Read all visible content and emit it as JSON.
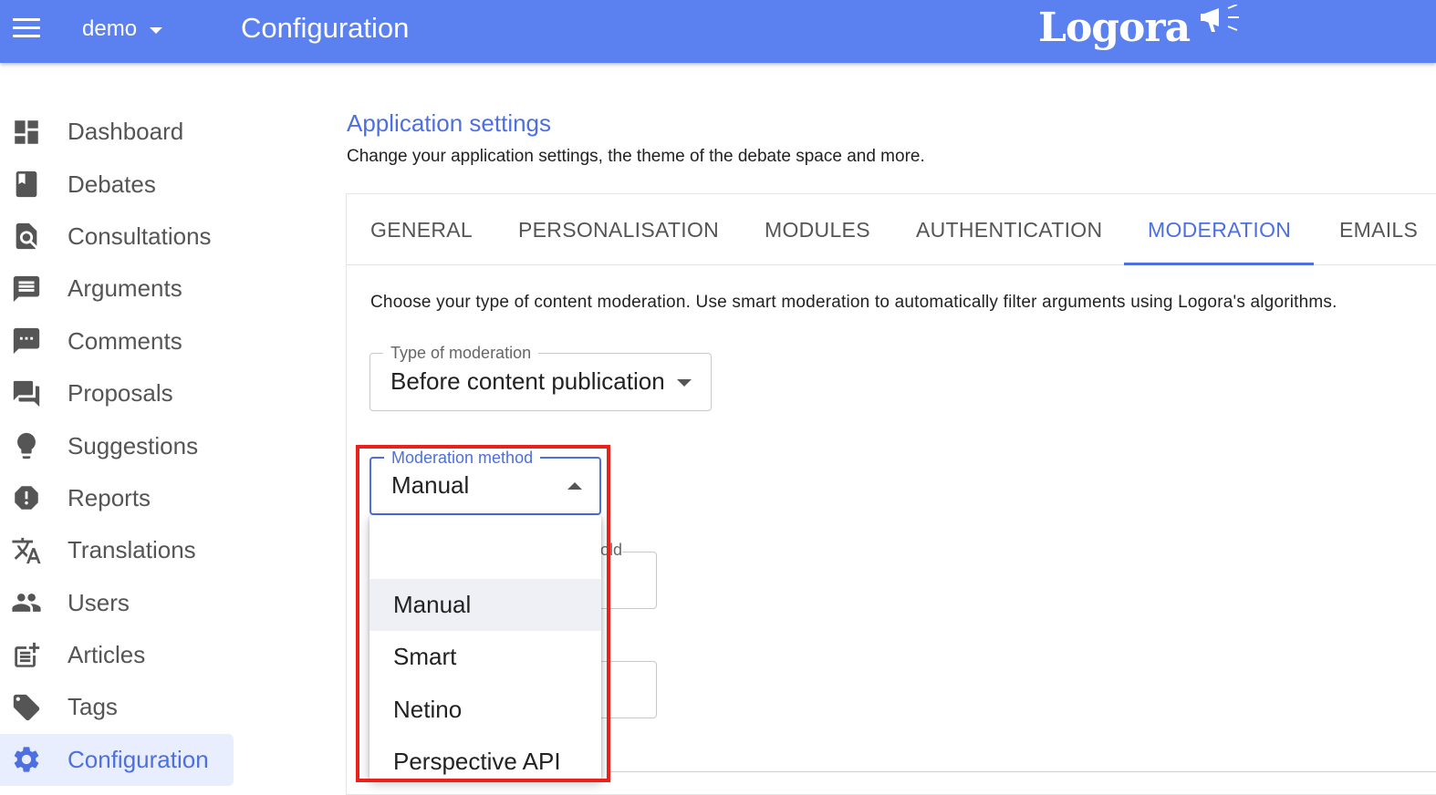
{
  "header": {
    "app_name": "demo",
    "title": "Configuration",
    "brand": "Logora"
  },
  "sidebar": {
    "items": [
      {
        "label": "Dashboard",
        "icon": "dashboard-icon"
      },
      {
        "label": "Debates",
        "icon": "book-icon"
      },
      {
        "label": "Consultations",
        "icon": "search-document-icon"
      },
      {
        "label": "Arguments",
        "icon": "message-icon"
      },
      {
        "label": "Comments",
        "icon": "comment-dots-icon"
      },
      {
        "label": "Proposals",
        "icon": "forum-icon"
      },
      {
        "label": "Suggestions",
        "icon": "lightbulb-icon"
      },
      {
        "label": "Reports",
        "icon": "alert-icon"
      },
      {
        "label": "Translations",
        "icon": "translate-icon"
      },
      {
        "label": "Users",
        "icon": "people-icon"
      },
      {
        "label": "Articles",
        "icon": "post-add-icon"
      },
      {
        "label": "Tags",
        "icon": "tag-icon"
      },
      {
        "label": "Configuration",
        "icon": "gear-icon"
      }
    ],
    "active_index": 12
  },
  "main": {
    "section_title": "Application settings",
    "section_desc": "Change your application settings, the theme of the debate space and more.",
    "tabs": [
      {
        "label": "GENERAL"
      },
      {
        "label": "PERSONALISATION"
      },
      {
        "label": "MODULES"
      },
      {
        "label": "AUTHENTICATION"
      },
      {
        "label": "MODERATION"
      },
      {
        "label": "EMAILS"
      }
    ],
    "active_tab": "MODERATION",
    "moderation_desc": "Choose your type of content moderation. Use smart moderation to automatically filter arguments using Logora's algorithms.",
    "type_field": {
      "label": "Type of moderation",
      "value": "Before content publication"
    },
    "method_field": {
      "label": "Moderation method",
      "value": "Manual"
    },
    "hidden_field_legend": "old",
    "method_options": [
      "Manual",
      "Smart",
      "Netino",
      "Perspective API"
    ],
    "selected_option": "Manual"
  },
  "colors": {
    "topbar": "#5b81f0",
    "accent": "#4d6fe0",
    "highlight": "#e8221b"
  }
}
